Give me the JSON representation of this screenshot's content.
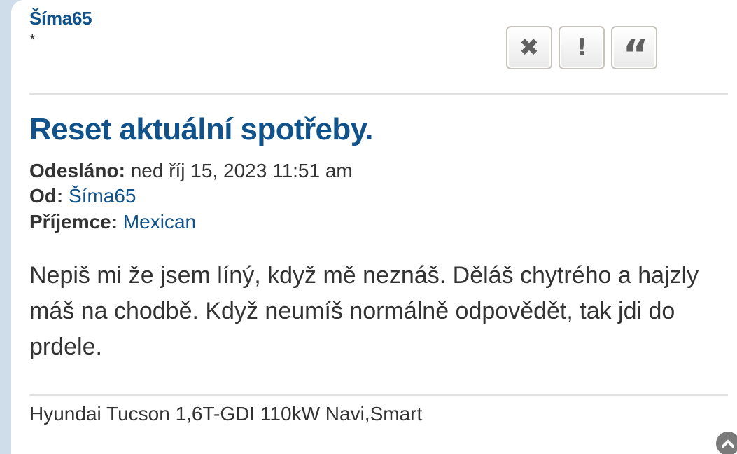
{
  "post": {
    "author": {
      "name": "Šíma65",
      "rank": "*"
    },
    "actions": [
      {
        "name": "delete",
        "icon": "close-icon",
        "glyph": "✖"
      },
      {
        "name": "report",
        "icon": "exclamation-icon",
        "glyph": "!"
      },
      {
        "name": "quote",
        "icon": "quote-icon",
        "glyph": "“"
      }
    ],
    "subject": "Reset aktuální spotřeby.",
    "meta": {
      "sent_label": "Odesláno:",
      "sent_value": "ned říj 15, 2023 11:51 am",
      "from_label": "Od:",
      "from_value": "Šíma65",
      "to_label": "Příjemce:",
      "to_value": "Mexican"
    },
    "message": "Nepiš mi že jsem líný, když mě neznáš. Děláš chytrého a hajzly máš na chodbě. Když neumíš normálně odpovědět, tak jdi do prdele.",
    "signature": "Hyundai Tucson 1,6T-GDI 110kW Navi,Smart"
  },
  "back_to_top": {
    "icon": "chevron-up-icon"
  }
}
